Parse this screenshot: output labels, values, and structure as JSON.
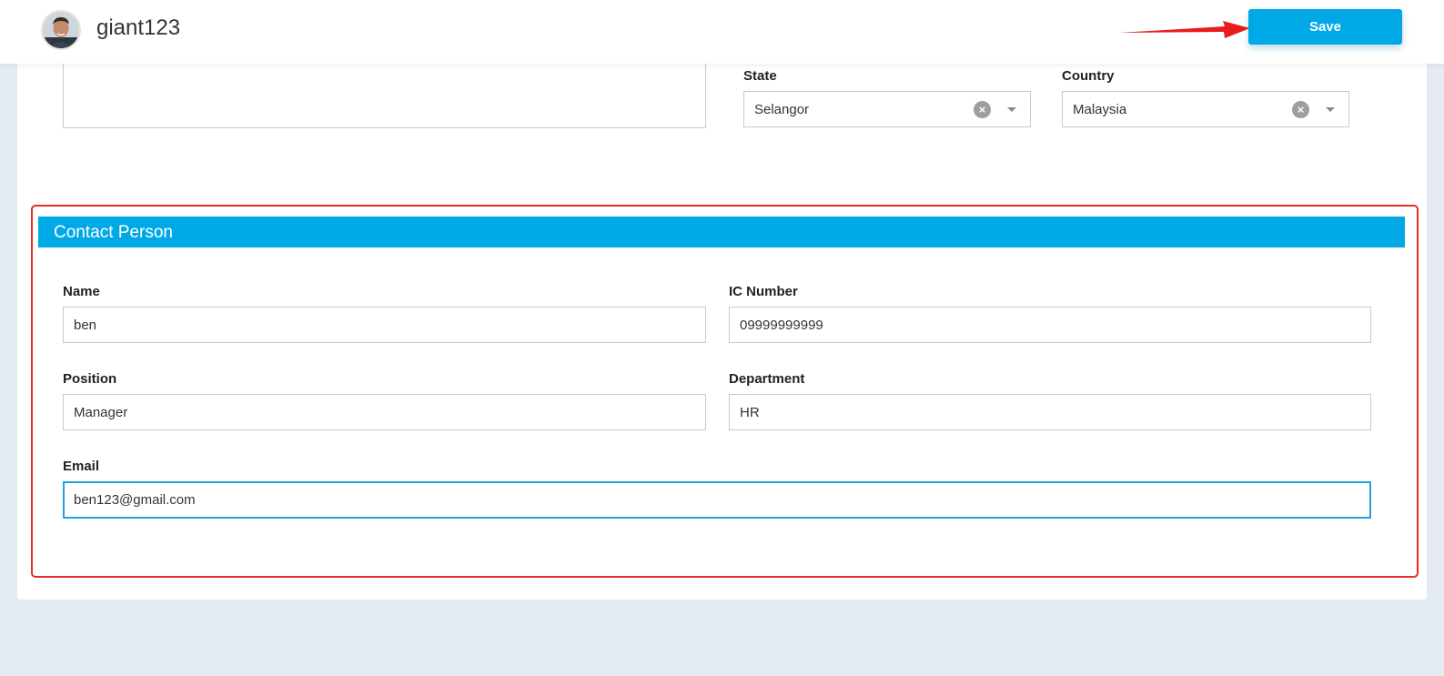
{
  "header": {
    "username": "giant123",
    "save_label": "Save"
  },
  "address": {
    "state": {
      "label": "State",
      "value": "Selangor"
    },
    "country": {
      "label": "Country",
      "value": "Malaysia"
    }
  },
  "contact_person": {
    "title": "Contact Person",
    "name": {
      "label": "Name",
      "value": "ben"
    },
    "ic_number": {
      "label": "IC Number",
      "value": "09999999999"
    },
    "position": {
      "label": "Position",
      "value": "Manager"
    },
    "department": {
      "label": "Department",
      "value": "HR"
    },
    "email": {
      "label": "Email",
      "value": "ben123@gmail.com"
    }
  },
  "icons": {
    "avatar": "user-avatar",
    "arrow": "red-arrow-icon",
    "clear": "clear-icon",
    "dropdown": "chevron-down-icon"
  },
  "colors": {
    "accent": "#00a8e6",
    "highlight": "#e82a2a",
    "page_bg": "#e4ebf2"
  }
}
